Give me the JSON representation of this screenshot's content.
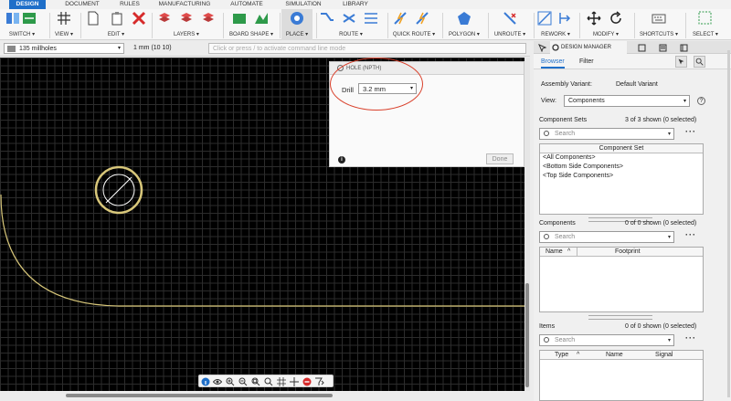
{
  "tabs": [
    {
      "label": "DESIGN",
      "active": true
    },
    {
      "label": "DOCUMENT"
    },
    {
      "label": "RULES"
    },
    {
      "label": "MANUFACTURING"
    },
    {
      "label": "AUTOMATE"
    },
    {
      "label": "SIMULATION"
    },
    {
      "label": "LIBRARY"
    }
  ],
  "toolbar": {
    "groups": [
      "SWITCH ▾",
      "VIEW ▾",
      "EDIT ▾",
      "LAYERS ▾",
      "BOARD SHAPE ▾",
      "PLACE ▾",
      "ROUTE ▾",
      "QUICK ROUTE ▾",
      "POLYGON ▾",
      "UNROUTE ▾",
      "REWORK ▾",
      "MODIFY ▾",
      "SHORTCUTS ▾",
      "SELECT ▾"
    ],
    "accent": "#1f6fc9"
  },
  "command": {
    "layer": "135 millholes",
    "grid": "1 mm (10 10)",
    "placeholder": "Click or press / to activate command line mode"
  },
  "dialog": {
    "title": "HOLE (NPTH)",
    "drill_label": "Drill",
    "drill_value": "3.2 mm",
    "done_label": "Done"
  },
  "panel": {
    "tab_title": "DESIGN MANAGER",
    "subtabs": [
      "Browser",
      "Filter"
    ],
    "assembly_label": "Assembly Variant:",
    "assembly_value": "Default Variant",
    "view_label": "View:",
    "view_value": "Components",
    "component_sets": {
      "title": "Component Sets",
      "shown": "3 of 3 shown (0 selected)",
      "search": "Search",
      "header": "Component Set",
      "rows": [
        "<All Components>",
        "<Bottom Side Components>",
        "<Top Side Components>"
      ]
    },
    "components": {
      "title": "Components",
      "shown": "0 of 0 shown (0 selected)",
      "search": "Search",
      "headers": [
        "Name",
        "Footprint"
      ]
    },
    "items": {
      "title": "Items",
      "shown": "0 of 0 shown (0 selected)",
      "search": "Search",
      "headers": [
        "Type",
        "Name",
        "Signal"
      ]
    }
  },
  "colors": {
    "board_outline": "#d8c77a",
    "highlight_ring": "#d9402b"
  }
}
